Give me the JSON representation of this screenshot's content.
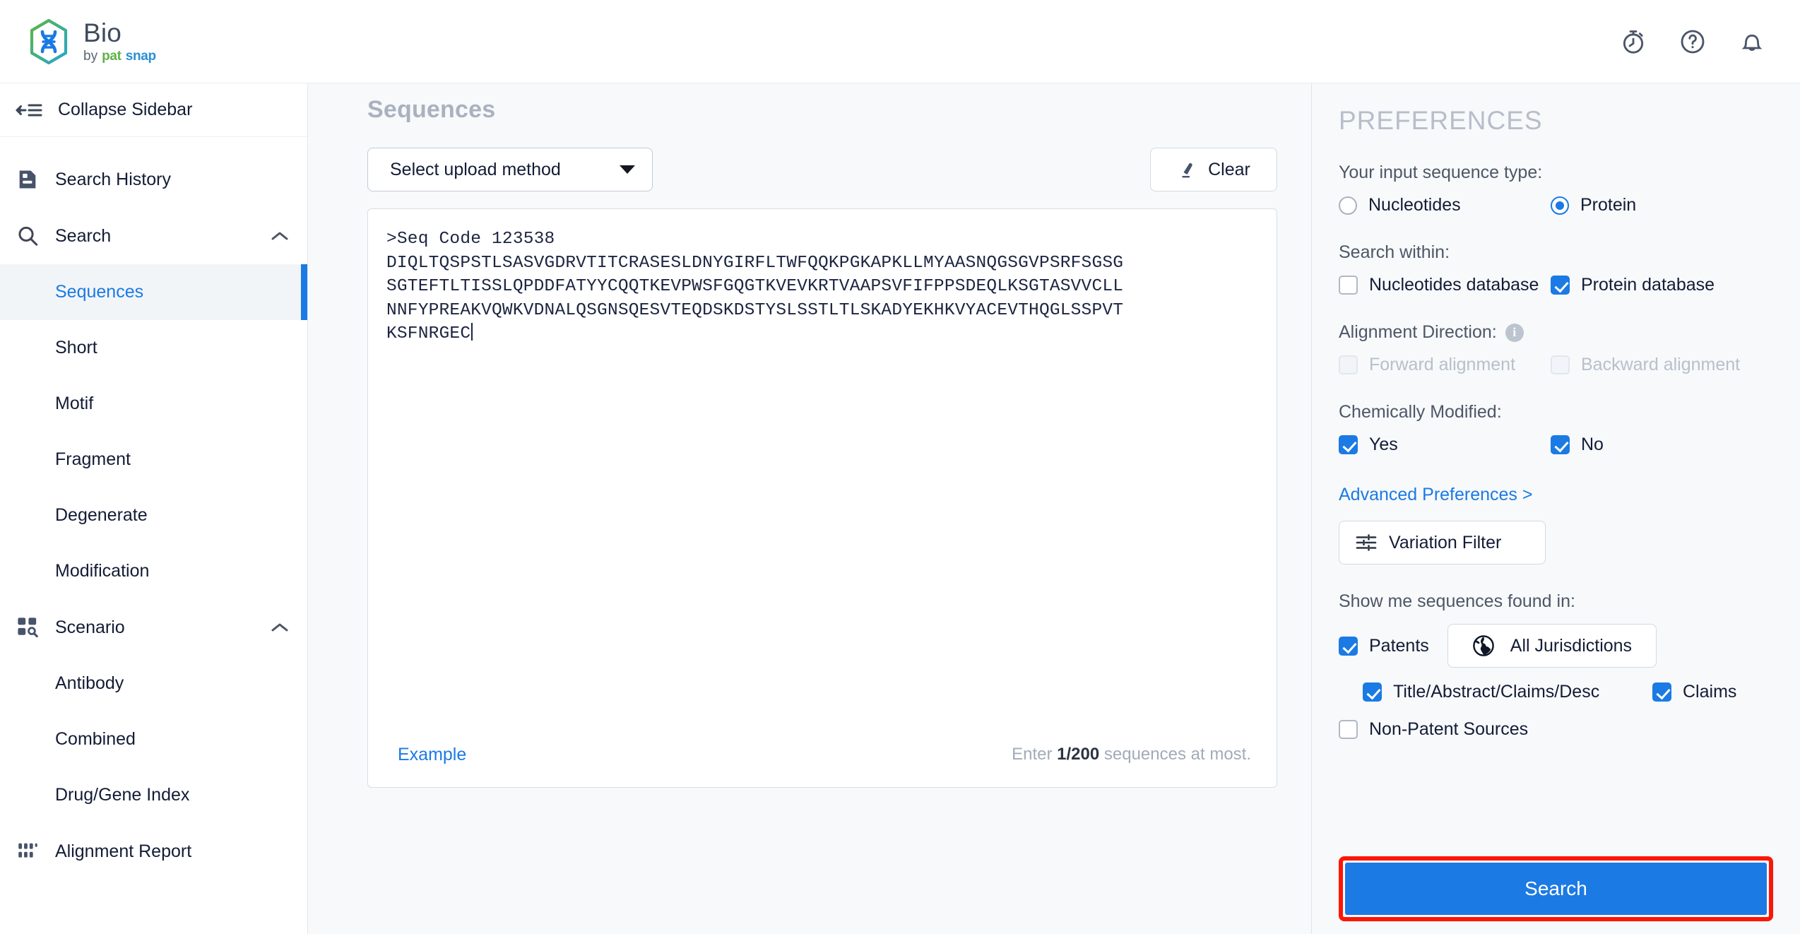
{
  "header": {
    "logo": {
      "title": "Bio",
      "by": "by",
      "pat": "pat",
      "snap": "snap"
    },
    "icons": [
      {
        "name": "stopwatch-icon",
        "label": "Usage / Quota"
      },
      {
        "name": "help-circle-icon",
        "label": "Help"
      },
      {
        "name": "bell-icon",
        "label": "Notifications"
      }
    ]
  },
  "sidebar": {
    "collapse_label": "Collapse Sidebar",
    "collapse_icon": "collapse-sidebar-icon",
    "groups": [
      {
        "label": "Search History",
        "icon": "document-lines-icon",
        "type": "link",
        "chevron": null
      },
      {
        "label": "Search",
        "icon": "magnifier-icon",
        "type": "group",
        "chevron": "chevron-up-icon",
        "items": [
          {
            "label": "Sequences",
            "active": true
          },
          {
            "label": "Short",
            "active": false
          },
          {
            "label": "Motif",
            "active": false
          },
          {
            "label": "Fragment",
            "active": false
          },
          {
            "label": "Degenerate",
            "active": false
          },
          {
            "label": "Modification",
            "active": false
          }
        ]
      },
      {
        "label": "Scenario",
        "icon": "grid-search-icon",
        "type": "group",
        "chevron": "chevron-up-icon",
        "items": [
          {
            "label": "Antibody",
            "active": false
          },
          {
            "label": "Combined",
            "active": false
          },
          {
            "label": "Drug/Gene Index",
            "active": false
          }
        ]
      },
      {
        "label": "Alignment Report",
        "icon": "dots-grid-icon",
        "type": "link",
        "chevron": null
      }
    ]
  },
  "main": {
    "page_title": "Sequences",
    "upload_select": {
      "label": "Select upload method",
      "icon": "caret-down-icon"
    },
    "clear_button": {
      "label": "Clear",
      "icon": "eraser-icon"
    },
    "sequence_input": {
      "line1": ">Seq Code 123538",
      "line2": "DIQLTQSPSTLSASVGDRVTITCRASESLDNYGIRFLTWFQQKPGKAPKLLMYAASNQGSGVPSRFSGSG",
      "line3": "SGTEFTLTISSLQPDDFATYYCQQTKEVPWSFGQGTKVEVKRTVAAPSVFIFPPSDEQLKSGTASVVCLL",
      "line4": "NNFYPREAKVQWKVDNALQSGNSQESVTEQDSKDSTYSLSSTLTLSKADYEKHKVYACEVTHQGLSSPVT",
      "line5": "KSFNRGEC"
    },
    "example_link": "Example",
    "counter_prefix": "Enter ",
    "counter_value": "1/200",
    "counter_suffix": " sequences at most."
  },
  "preferences": {
    "title": "PREFERENCES",
    "input_type": {
      "label": "Your input sequence type:",
      "options": [
        {
          "label": "Nucleotides",
          "selected": false
        },
        {
          "label": "Protein",
          "selected": true
        }
      ]
    },
    "search_within": {
      "label": "Search within:",
      "options": [
        {
          "label": "Nucleotides database",
          "checked": false
        },
        {
          "label": "Protein database",
          "checked": true
        }
      ]
    },
    "alignment_direction": {
      "label": "Alignment Direction:",
      "info_icon": "info-icon",
      "info_glyph": "i",
      "options": [
        {
          "label": "Forward alignment",
          "checked": false,
          "disabled": true
        },
        {
          "label": "Backward alignment",
          "checked": false,
          "disabled": true
        }
      ]
    },
    "chemically_modified": {
      "label": "Chemically Modified:",
      "options": [
        {
          "label": "Yes",
          "checked": true
        },
        {
          "label": "No",
          "checked": true
        }
      ]
    },
    "advanced_link": "Advanced Preferences >",
    "variation_filter": {
      "label": "Variation Filter",
      "icon": "filter-sliders-icon"
    },
    "found_in": {
      "label": "Show me sequences found in:",
      "patents": {
        "label": "Patents",
        "checked": true
      },
      "jurisdictions_button": {
        "label": "All Jurisdictions",
        "icon": "globe-icon"
      },
      "sub_options": [
        {
          "label": "Title/Abstract/Claims/Desc",
          "checked": true
        },
        {
          "label": "Claims",
          "checked": true
        }
      ],
      "non_patent": {
        "label": "Non-Patent Sources",
        "checked": false
      }
    },
    "search_button": {
      "label": "Search",
      "highlight_color": "#fc1705",
      "accent_color": "#1b7ae4"
    }
  }
}
